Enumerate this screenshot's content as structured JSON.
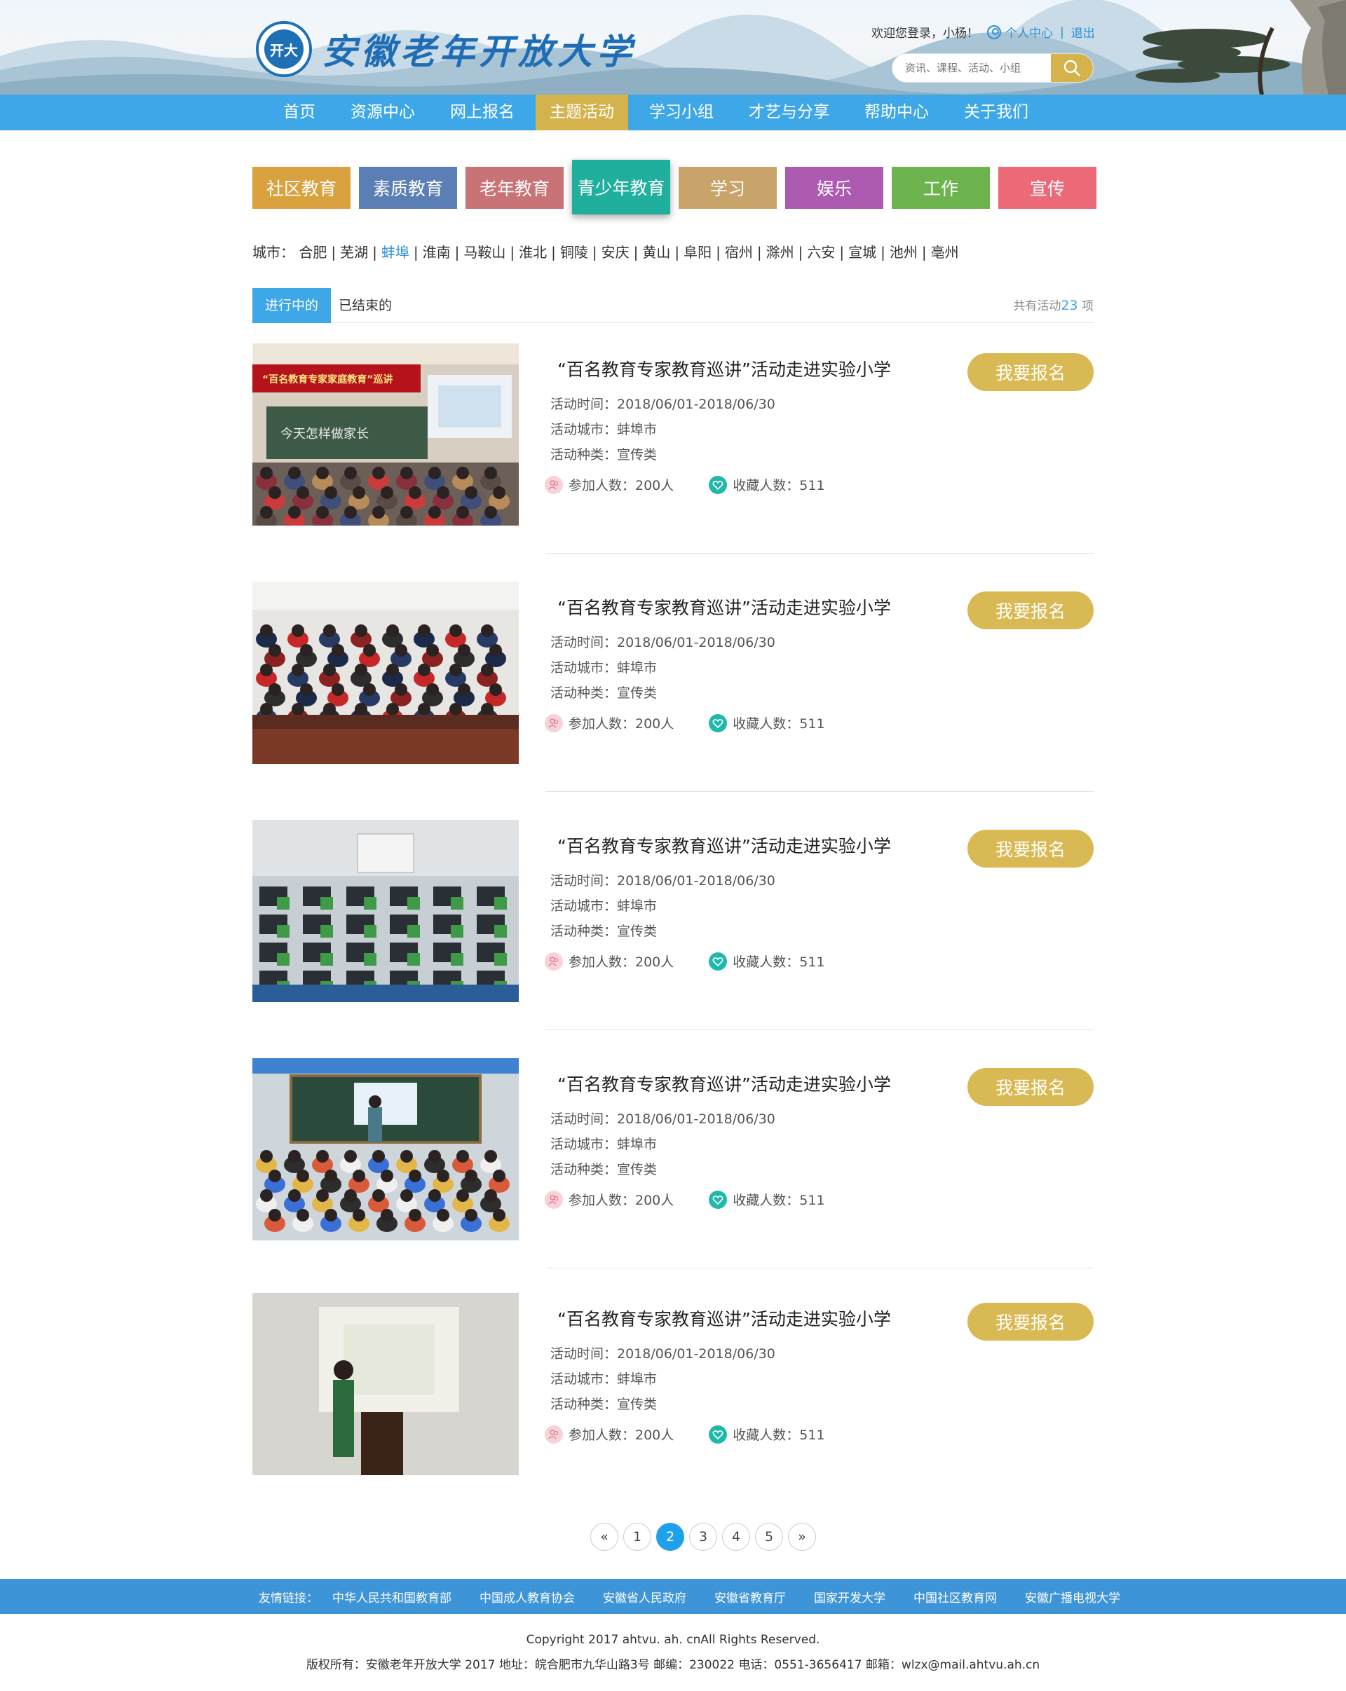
{
  "header": {
    "logo_seal_text": "开大",
    "site_name": "安徽老年开放大学",
    "welcome": "欢迎您登录，小杨！",
    "personal_center": "个人中心",
    "separator": "|",
    "logout": "退出",
    "search_placeholder": "资讯、课程、活动、小组"
  },
  "nav": [
    {
      "label": "首页",
      "active": false
    },
    {
      "label": "资源中心",
      "active": false
    },
    {
      "label": "网上报名",
      "active": false
    },
    {
      "label": "主题活动",
      "active": true
    },
    {
      "label": "学习小组",
      "active": false
    },
    {
      "label": "才艺与分享",
      "active": false
    },
    {
      "label": "帮助中心",
      "active": false
    },
    {
      "label": "关于我们",
      "active": false
    }
  ],
  "categories": [
    {
      "label": "社区教育",
      "color": "#d9a23f"
    },
    {
      "label": "素质教育",
      "color": "#5b7fb5"
    },
    {
      "label": "老年教育",
      "color": "#c97377"
    },
    {
      "label": "青少年教育",
      "color": "#1faf9c",
      "active": true
    },
    {
      "label": "学习",
      "color": "#c8a46b"
    },
    {
      "label": "娱乐",
      "color": "#ad5bb0"
    },
    {
      "label": "工作",
      "color": "#6db44e"
    },
    {
      "label": "宣传",
      "color": "#ec6a78"
    }
  ],
  "city_filter": {
    "label": "城市：",
    "cities": [
      {
        "name": "合肥",
        "active": false
      },
      {
        "name": "芜湖",
        "active": false
      },
      {
        "name": "蚌埠",
        "active": true
      },
      {
        "name": "淮南",
        "active": false
      },
      {
        "name": "马鞍山",
        "active": false
      },
      {
        "name": "淮北",
        "active": false
      },
      {
        "name": "铜陵",
        "active": false
      },
      {
        "name": "安庆",
        "active": false
      },
      {
        "name": "黄山",
        "active": false
      },
      {
        "name": "阜阳",
        "active": false
      },
      {
        "name": "宿州",
        "active": false
      },
      {
        "name": "滁州",
        "active": false
      },
      {
        "name": "六安",
        "active": false
      },
      {
        "name": "宣城",
        "active": false
      },
      {
        "name": "池州",
        "active": false
      },
      {
        "name": "亳州",
        "active": false
      }
    ]
  },
  "status_tabs": {
    "ongoing": "进行中的",
    "ended": "已结束的",
    "total_prefix": "共有活动",
    "total_count": "23",
    "total_suffix": " 项"
  },
  "activities": [
    {
      "title": "“百名教育专家教育巡讲”活动走进实验小学",
      "time": "活动时间：2018/06/01-2018/06/30",
      "city": "活动城市：蚌埠市",
      "type": "活动种类：宣传类",
      "participants": "参加人数：200人",
      "favorites": "收藏人数：511",
      "button": "我要报名",
      "banner_text": "“百名教育专家家庭教育”巡讲",
      "board_text": "今天怎样做家长",
      "scene": "classroom-lecture"
    },
    {
      "title": "“百名教育专家教育巡讲”活动走进实验小学",
      "time": "活动时间：2018/06/01-2018/06/30",
      "city": "活动城市：蚌埠市",
      "type": "活动种类：宣传类",
      "participants": "参加人数：200人",
      "favorites": "收藏人数：511",
      "button": "我要报名",
      "scene": "students-seated"
    },
    {
      "title": "“百名教育专家教育巡讲”活动走进实验小学",
      "time": "活动时间：2018/06/01-2018/06/30",
      "city": "活动城市：蚌埠市",
      "type": "活动种类：宣传类",
      "participants": "参加人数：200人",
      "favorites": "收藏人数：511",
      "button": "我要报名",
      "scene": "computer-lab"
    },
    {
      "title": "“百名教育专家教育巡讲”活动走进实验小学",
      "time": "活动时间：2018/06/01-2018/06/30",
      "city": "活动城市：蚌埠市",
      "type": "活动种类：宣传类",
      "participants": "参加人数：200人",
      "favorites": "收藏人数：511",
      "button": "我要报名",
      "scene": "classroom-teacher"
    },
    {
      "title": "“百名教育专家教育巡讲”活动走进实验小学",
      "time": "活动时间：2018/06/01-2018/06/30",
      "city": "活动城市：蚌埠市",
      "type": "活动种类：宣传类",
      "participants": "参加人数：200人",
      "favorites": "收藏人数：511",
      "button": "我要报名",
      "scene": "podium-speaker"
    }
  ],
  "pagination": {
    "prev": "«",
    "pages": [
      "1",
      "2",
      "3",
      "4",
      "5"
    ],
    "current": "2",
    "next": "»"
  },
  "footer": {
    "links_label": "友情链接：",
    "links": [
      "中华人民共和国教育部",
      "中国成人教育协会",
      "安徽省人民政府",
      "安徽省教育厅",
      "国家开发大学",
      "中国社区教育网",
      "安徽广播电视大学"
    ],
    "copyright": "Copyright 2017 ahtvu. ah. cnAll Rights Reserved.",
    "address": "版权所有：安徽老年开放大学 2017 地址：皖合肥市九华山路3号 邮编：230022 电话：0551-3656417 邮箱：wlzx@mail.ahtvu.ah.cn"
  },
  "colors": {
    "nav_bg": "#3da7e7",
    "accent_gold": "#d4b24c",
    "link_blue": "#2a8fd6",
    "footer_bg": "#3d94d6"
  }
}
